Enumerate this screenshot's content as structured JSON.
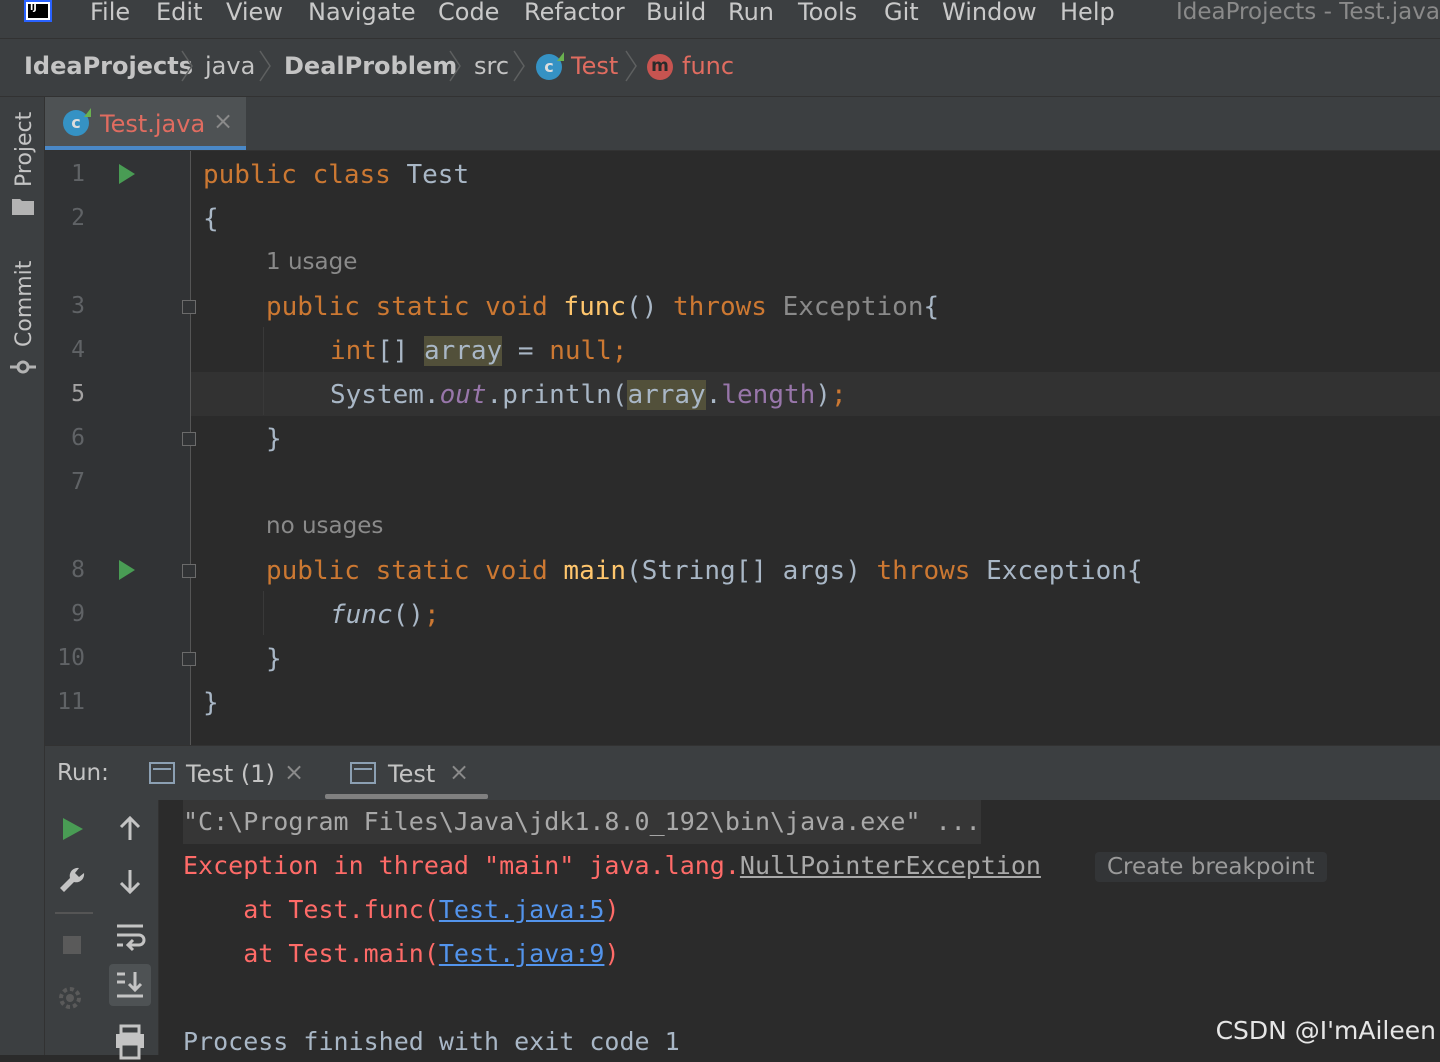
{
  "menubar": {
    "items": [
      "File",
      "Edit",
      "View",
      "Navigate",
      "Code",
      "Refactor",
      "Build",
      "Run",
      "Tools",
      "Git",
      "Window",
      "Help"
    ],
    "window_title": "IdeaProjects - Test.java"
  },
  "breadcrumbs": [
    "IdeaProjects",
    "java",
    "DealProblem",
    "src",
    "Test",
    "func"
  ],
  "left_strip": {
    "project": "Project",
    "commit": "Commit"
  },
  "editor_tab": {
    "label": "Test.java",
    "close": "×"
  },
  "editor": {
    "line_numbers": [
      "1",
      "2",
      "3",
      "4",
      "5",
      "6",
      "7",
      "8",
      "9",
      "10",
      "11"
    ],
    "inlay_usage_func": "1 usage",
    "inlay_usage_main": "no usages",
    "lines": {
      "l1_kw": "public class ",
      "l1_name": "Test",
      "l2": "{",
      "l3_kw": "public static void ",
      "l3_fn": "func",
      "l3_paren": "() ",
      "l3_throws": "throws ",
      "l3_exc": "Exception",
      "l3_brace": "{",
      "l4_kw": "int",
      "l4_br": "[] ",
      "l4_var": "array",
      "l4_eq": " = ",
      "l4_null": "null;",
      "l5_sys": "System.",
      "l5_out": "out",
      "l5_println": ".println(",
      "l5_var": "array",
      "l5_dot": ".",
      "l5_len": "length",
      "l5_close": ")",
      "l5_semi": ";",
      "l6": "}",
      "l8_kw": "public static void ",
      "l8_fn": "main",
      "l8_args": "(String[] args) ",
      "l8_throws": "throws ",
      "l8_exc": "Exception{",
      "l9_call": "func",
      "l9_paren": "()",
      "l9_semi": ";",
      "l10": "}",
      "l11": "}"
    }
  },
  "run_panel": {
    "label": "Run:",
    "tabs": [
      {
        "label": "Test (1)",
        "close": "×"
      },
      {
        "label": "Test",
        "close": "×"
      }
    ]
  },
  "console": {
    "cmd": "\"C:\\Program Files\\Java\\jdk1.8.0_192\\bin\\java.exe\" ...",
    "exc_prefix": "Exception in thread \"main\" java.lang.",
    "exc_name": "NullPointerException",
    "create_breakpoint": "Create breakpoint",
    "trace1_prefix": "    at Test.func(",
    "trace1_link": "Test.java:5",
    "trace1_suffix": ")",
    "trace2_prefix": "    at Test.main(",
    "trace2_link": "Test.java:9",
    "trace2_suffix": ")",
    "finished": "Process finished with exit code 1"
  },
  "watermark": "CSDN @I'mAileen",
  "colors": {
    "keyword": "#cc7832",
    "function": "#ffc66d",
    "field": "#9876aa",
    "error": "#ff6b68",
    "link": "#5394ec"
  }
}
